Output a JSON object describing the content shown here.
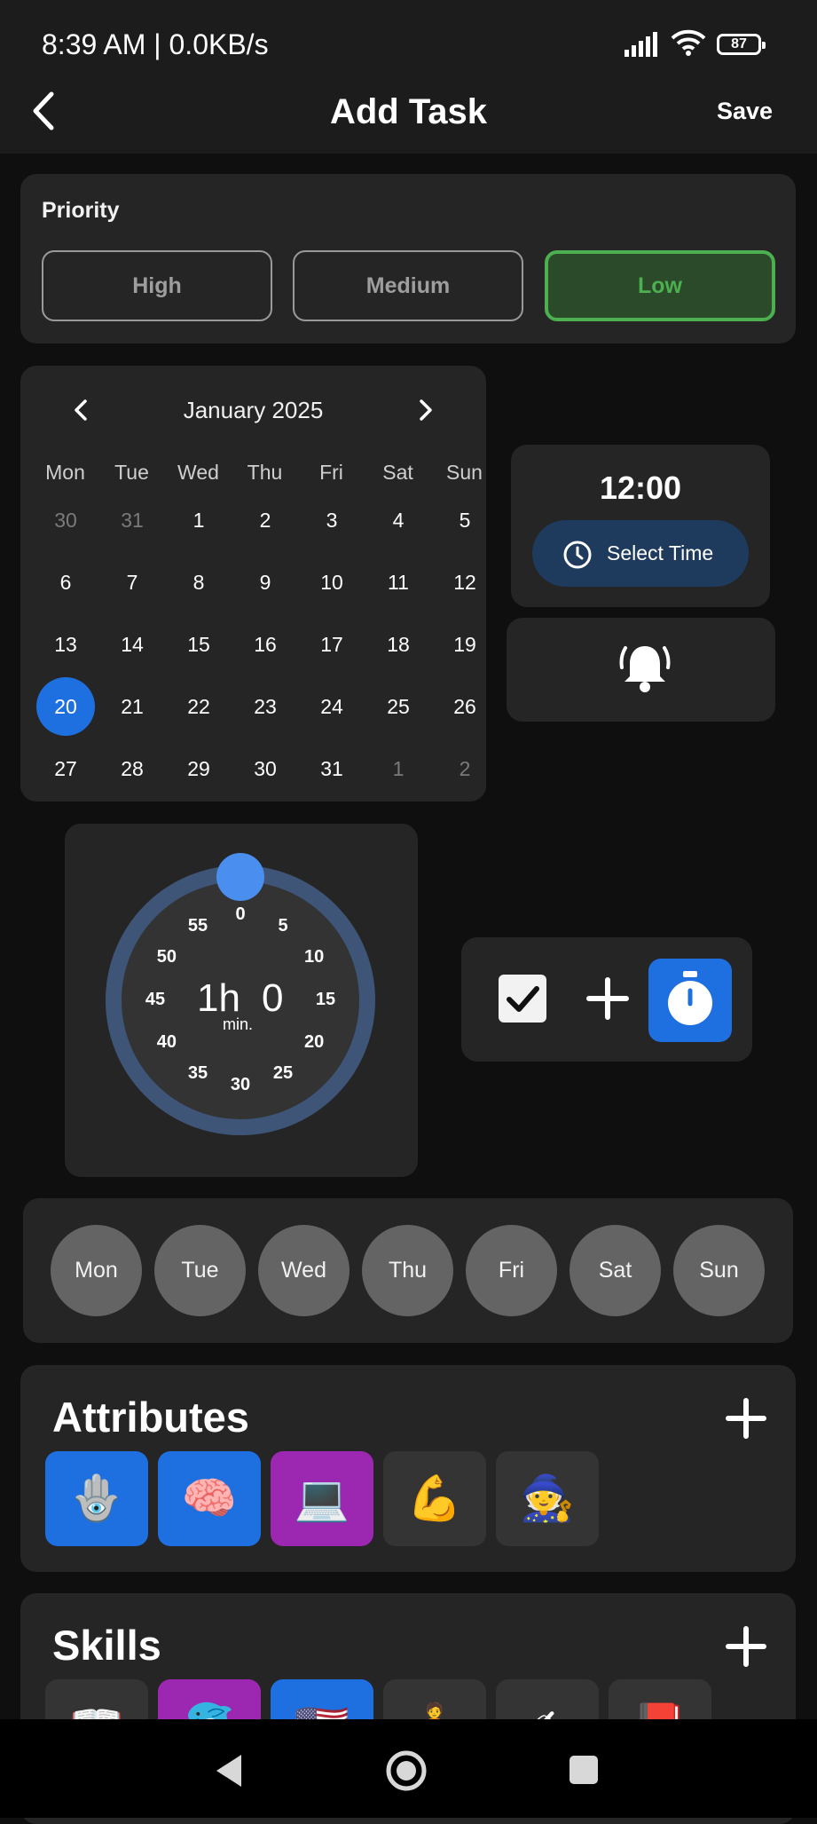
{
  "status_bar": {
    "time_speed": "8:39 AM | 0.0KB/s",
    "battery": "87"
  },
  "header": {
    "title": "Add Task",
    "save_label": "Save"
  },
  "priority": {
    "label": "Priority",
    "options": [
      "High",
      "Medium",
      "Low"
    ],
    "selected": "Low"
  },
  "calendar": {
    "month_label": "January 2025",
    "weekdays": [
      "Mon",
      "Tue",
      "Wed",
      "Thu",
      "Fri",
      "Sat",
      "Sun"
    ],
    "weeks": [
      [
        "30",
        "31",
        "1",
        "2",
        "3",
        "4",
        "5"
      ],
      [
        "6",
        "7",
        "8",
        "9",
        "10",
        "11",
        "12"
      ],
      [
        "13",
        "14",
        "15",
        "16",
        "17",
        "18",
        "19"
      ],
      [
        "20",
        "21",
        "22",
        "23",
        "24",
        "25",
        "26"
      ],
      [
        "27",
        "28",
        "29",
        "30",
        "31",
        "1",
        "2"
      ]
    ],
    "selected_day": "20"
  },
  "time": {
    "value": "12:00",
    "button_label": "Select Time"
  },
  "duration": {
    "hours_label": "1h",
    "minutes_value": "0",
    "unit_label": "min.",
    "dial_numbers": [
      "0",
      "5",
      "10",
      "15",
      "20",
      "25",
      "30",
      "35",
      "40",
      "45",
      "50",
      "55"
    ]
  },
  "repeat_days": [
    "Mon",
    "Tue",
    "Wed",
    "Thu",
    "Fri",
    "Sat",
    "Sun"
  ],
  "attributes": {
    "title": "Attributes",
    "tiles": [
      {
        "emoji": "🪬",
        "color": "#1e6fe0"
      },
      {
        "emoji": "🧠",
        "color": "#1e6fe0"
      },
      {
        "emoji": "💻",
        "color": "#9c27b0"
      },
      {
        "emoji": "💪",
        "color": "#343434"
      },
      {
        "emoji": "🧙",
        "color": "#343434"
      }
    ]
  },
  "skills": {
    "title": "Skills",
    "tiles": [
      {
        "emoji": "📖",
        "color": "#343434"
      },
      {
        "emoji": "🐬",
        "color": "#9c27b0"
      },
      {
        "emoji": "🇺🇸",
        "color": "#1e6fe0"
      },
      {
        "emoji": "🧍",
        "color": "#343434"
      },
      {
        "emoji": "✍",
        "color": "#343434"
      },
      {
        "emoji": "📕",
        "color": "#343434"
      }
    ]
  },
  "colors": {
    "accent": "#1e6fe0",
    "low": "#4caf50",
    "card": "#252525",
    "background": "#0f0f0f"
  }
}
